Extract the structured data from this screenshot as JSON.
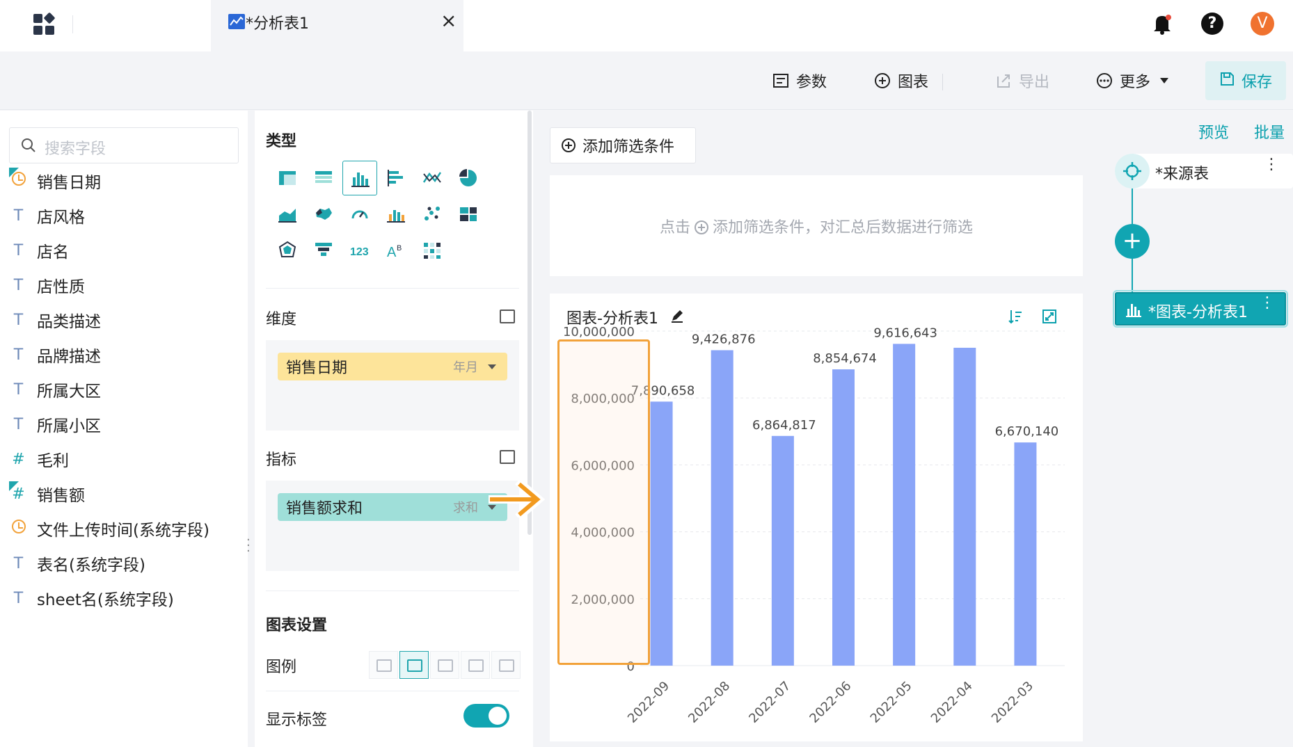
{
  "topbar": {
    "tab_title": "*分析表1",
    "tab_close": "×",
    "help": "?",
    "avatar": "V"
  },
  "toolbar": {
    "params": "参数",
    "chart": "图表",
    "export": "导出",
    "more": "更多",
    "save": "保存"
  },
  "fields": {
    "search_placeholder": "搜索字段",
    "items": [
      {
        "label": "销售日期",
        "type": "date-icon"
      },
      {
        "label": "店风格",
        "type": "text-icon"
      },
      {
        "label": "店名",
        "type": "text-icon"
      },
      {
        "label": "店性质",
        "type": "text-icon"
      },
      {
        "label": "品类描述",
        "type": "text-icon"
      },
      {
        "label": "品牌描述",
        "type": "text-icon"
      },
      {
        "label": "所属大区",
        "type": "text-icon"
      },
      {
        "label": "所属小区",
        "type": "text-icon"
      },
      {
        "label": "毛利",
        "type": "number-icon"
      },
      {
        "label": "销售额",
        "type": "number-icon"
      },
      {
        "label": "文件上传时间(系统字段)",
        "type": "date-icon"
      },
      {
        "label": "表名(系统字段)",
        "type": "text-icon"
      },
      {
        "label": "sheet名(系统字段)",
        "type": "text-icon"
      }
    ],
    "text_glyph": "T",
    "number_glyph": "#"
  },
  "config": {
    "type_title": "类型",
    "dimension_title": "维度",
    "dimension_pill": {
      "label": "销售日期",
      "sub": "年月"
    },
    "indicator_title": "指标",
    "indicator_pill": {
      "label": "销售额求和",
      "sub": "求和"
    },
    "chart_settings_title": "图表设置",
    "legend_label": "图例",
    "show_labels": "显示标签",
    "show_labels_on": true,
    "type_numbers_glyph": "123",
    "type_text_glyph": "A",
    "colors": {
      "accent": "#11a5b2"
    }
  },
  "filter": {
    "add_button": "添加筛选条件",
    "hint_prefix": "点击",
    "hint_suffix": "添加筛选条件，对汇总后数据进行筛选"
  },
  "chart": {
    "title": "图表-分析表1"
  },
  "chart_data": {
    "type": "bar",
    "categories": [
      "2022-09",
      "2022-08",
      "2022-07",
      "2022-06",
      "2022-05",
      "2022-04",
      "2022-03"
    ],
    "values": [
      7890658,
      9426876,
      6864817,
      8854674,
      9616643,
      9500000,
      6670140
    ],
    "data_labels": [
      "7,890,658",
      "9,426,876",
      "6,864,817",
      "8,854,674",
      "9,616,643",
      "",
      "6,670,140"
    ],
    "yticks": [
      0,
      2000000,
      4000000,
      6000000,
      8000000,
      10000000
    ],
    "ytick_labels": [
      "0",
      "2,000,000",
      "4,000,000",
      "6,000,000",
      "8,000,000",
      "10,000,000"
    ],
    "ylim": [
      0,
      9500000
    ],
    "grid": true,
    "bar_color": "#8aa5f8"
  },
  "flow": {
    "preview": "预览",
    "batch": "批量",
    "source_node": "*来源表",
    "chart_node": "*图表-分析表1",
    "plus": "+",
    "menu": "⋮"
  }
}
